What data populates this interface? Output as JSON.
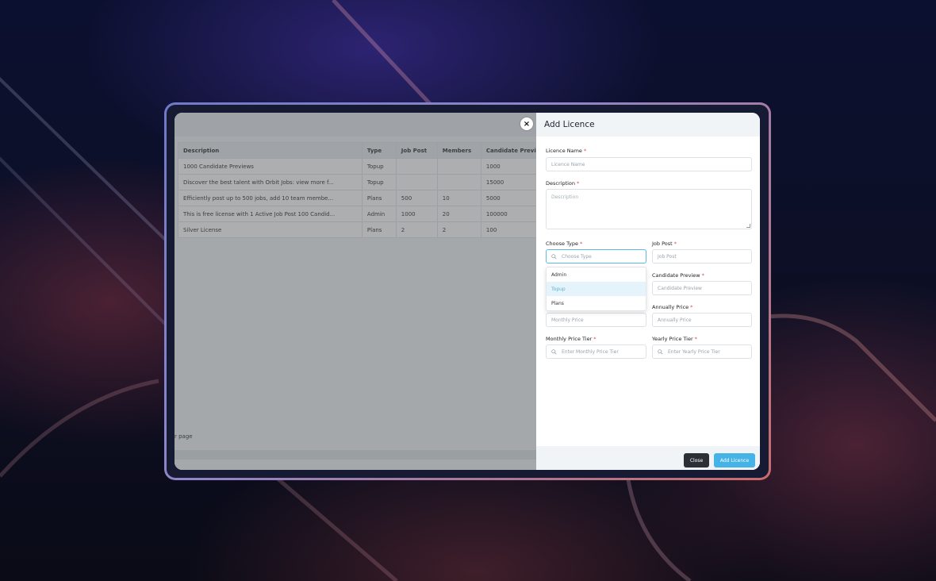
{
  "table": {
    "headers": [
      "Description",
      "Type",
      "Job Post",
      "Members",
      "Candidate Preview"
    ],
    "rows": [
      [
        "1000 Candidate Previews",
        "Topup",
        "",
        "",
        "1000"
      ],
      [
        "Discover the best talent with Orbit Jobs: view more f...",
        "Topup",
        "",
        "",
        "15000"
      ],
      [
        "Efficiently post up to 500 jobs, add 10 team membe...",
        "Plans",
        "500",
        "10",
        "5000"
      ],
      [
        "This is free license with 1 Active Job Post 100 Candid...",
        "Admin",
        "1000",
        "20",
        "100000"
      ],
      [
        "Silver License",
        "Plans",
        "2",
        "2",
        "100"
      ]
    ],
    "per_page_text": "r page"
  },
  "modal": {
    "close_icon_glyph": "×",
    "title": "Add Licence",
    "licence_name_label": "Licence Name",
    "licence_name_placeholder": "Licence Name",
    "description_label": "Description",
    "description_placeholder": "Description",
    "choose_type_label": "Choose Type",
    "choose_type_placeholder": "Choose Type",
    "type_options": [
      "Admin",
      "Topup",
      "Plans"
    ],
    "highlighted_option": "Topup",
    "job_post_label": "Job Post",
    "job_post_placeholder": "Job Post",
    "candidate_preview_label": "Candidate Preview",
    "candidate_preview_placeholder": "Candidate Preview",
    "monthly_price_placeholder": "Monthly Price",
    "annually_price_label": "Annually Price",
    "annually_price_placeholder": "Annually Price",
    "monthly_price_tier_label": "Monthly Price Tier",
    "monthly_price_tier_placeholder": "Enter Monthly Price Tier",
    "yearly_price_tier_label": "Yearly Price Tier",
    "yearly_price_tier_placeholder": "Enter Yearly Price Tier",
    "close_button": "Close",
    "add_button": "Add Licence",
    "required_mark": "*"
  },
  "colors": {
    "accent": "#45b3e6",
    "dark_button": "#2b2f36",
    "required": "#e04848"
  }
}
